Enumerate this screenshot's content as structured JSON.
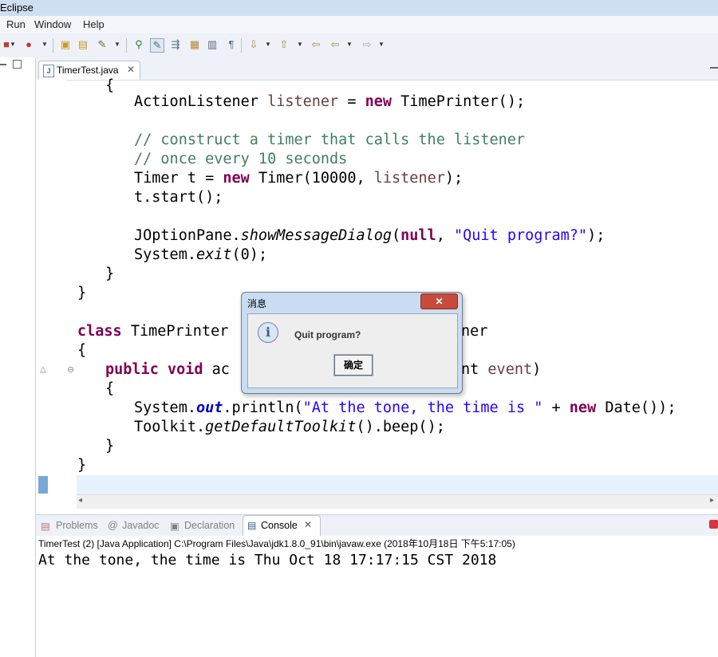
{
  "app": {
    "title": "Eclipse"
  },
  "menu": {
    "items": [
      "Run",
      "Window",
      "Help"
    ]
  },
  "editor": {
    "tab_label": "TimerTest.java",
    "tab_close": "✕"
  },
  "dialog": {
    "title": "消息",
    "close": "✕",
    "message": "Quit program?",
    "ok_label": "确定"
  },
  "bottom_panel": {
    "tabs": [
      "Problems",
      "Javadoc",
      "Declaration",
      "Console"
    ],
    "console_close": "✕",
    "console_info": "TimerTest (2) [Java Application] C:\\Program Files\\Java\\jdk1.8.0_91\\bin\\javaw.exe (2018年10月18日 下午5:17:05)",
    "console_output": "At the tone, the time is Thu Oct 18 17:17:15 CST 2018"
  },
  "code": {
    "l0": "{",
    "l1_type": "ActionListener ",
    "l1_var": "listener",
    "l1_eq": " = ",
    "l1_new": "new",
    "l1_rest": " TimePrinter();",
    "l2": "// construct a timer that calls the listener",
    "l3": "// once every 10 seconds",
    "l4_a": "Timer t = ",
    "l4_new": "new",
    "l4_b": " Timer(10000, ",
    "l4_var": "listener",
    "l4_c": ");",
    "l5": "t.start();",
    "l6_a": "JOptionPane.",
    "l6_m": "showMessageDialog",
    "l6_b": "(",
    "l6_null": "null",
    "l6_c": ", ",
    "l6_str": "\"Quit program?\"",
    "l6_d": ");",
    "l7_a": "System.",
    "l7_m": "exit",
    "l7_b": "(0);",
    "l8": "}",
    "l9": "}",
    "l10_kw": "class",
    "l10_a": " TimePrinter",
    "l10_b": "ner",
    "l11": "{",
    "l12_pub": "public",
    "l12_void": "void",
    "l12_a": " ac",
    "l12_b": "nt ",
    "l12_var": "event",
    "l12_c": ")",
    "l13": "{",
    "l14_a": "System.",
    "l14_out": "out",
    "l14_b": ".println(",
    "l14_str": "\"At the tone, the time is \"",
    "l14_c": " + ",
    "l14_new": "new",
    "l14_d": " Date());",
    "l15_a": "Toolkit.",
    "l15_m": "getDefaultToolkit",
    "l15_b": "().beep();",
    "l16": "}",
    "l17": "}"
  }
}
